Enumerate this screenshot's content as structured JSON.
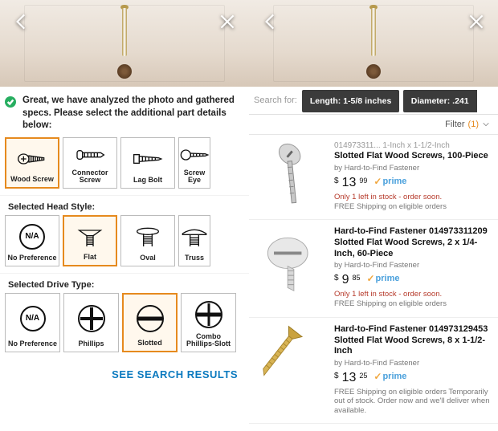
{
  "left": {
    "analysis": "Great, we have analyzed the photo and gathered specs. Please select the additional part details below:",
    "screwTypes": [
      {
        "label": "Wood Screw",
        "selected": true,
        "icon": "wood-screw"
      },
      {
        "label": "Connector Screw",
        "selected": false,
        "icon": "connector-screw"
      },
      {
        "label": "Lag Bolt",
        "selected": false,
        "icon": "lag-bolt"
      },
      {
        "label": "Screw Eye",
        "selected": false,
        "icon": "screw-eye",
        "partial": true
      }
    ],
    "headStyleLabel": "Selected Head Style:",
    "headStyles": [
      {
        "label": "No Preference",
        "na": true
      },
      {
        "label": "Flat",
        "selected": true,
        "icon": "flat-head"
      },
      {
        "label": "Oval",
        "icon": "oval-head"
      },
      {
        "label": "Truss",
        "icon": "truss-head",
        "partial": true
      }
    ],
    "driveLabel": "Selected Drive Type:",
    "driveTypes": [
      {
        "label": "No Preference",
        "na": true
      },
      {
        "label": "Phillips",
        "icon": "phillips"
      },
      {
        "label": "Slotted",
        "icon": "slotted",
        "selected": true
      },
      {
        "label": "Combo Phillips-Slott",
        "icon": "combo",
        "partial": true
      }
    ],
    "seeResults": "SEE SEARCH RESULTS"
  },
  "right": {
    "searchFor": "Search for:",
    "chips": [
      {
        "text": "Length: 1-5/8 inches"
      },
      {
        "text": "Diameter: .241",
        "partial": true
      }
    ],
    "filterLabel": "Filter",
    "filterCount": "(1)",
    "results": [
      {
        "titleTop": "014973311... 1-Inch x 1-1/2-Inch",
        "title": "Slotted Flat Wood Screws, 100-Piece",
        "by": "by Hard-to-Find Fastener",
        "priceWhole": "13",
        "priceCents": "99",
        "prime": true,
        "stock": "Only 1 left in stock - order soon.",
        "ship": "FREE Shipping on eligible orders",
        "thumb": "silver-screw"
      },
      {
        "title": "Hard-to-Find Fastener 014973311209 Slotted Flat Wood Screws, 2 x 1/4-Inch, 60-Piece",
        "by": "by Hard-to-Find Fastener",
        "priceWhole": "9",
        "priceCents": "85",
        "prime": true,
        "stock": "Only 1 left in stock - order soon.",
        "ship": "FREE Shipping on eligible orders",
        "thumb": "silver-screw-short"
      },
      {
        "title": "Hard-to-Find Fastener 014973129453 Slotted Flat Wood Screws, 8 x 1-1/2-Inch",
        "by": "by Hard-to-Find Fastener",
        "priceWhole": "13",
        "priceCents": "25",
        "prime": true,
        "stock": "",
        "ship": "FREE Shipping on eligible orders\nTemporarily out of stock. Order now and we'll deliver when available.",
        "thumb": "brass-screw"
      }
    ]
  },
  "naText": "N/A"
}
